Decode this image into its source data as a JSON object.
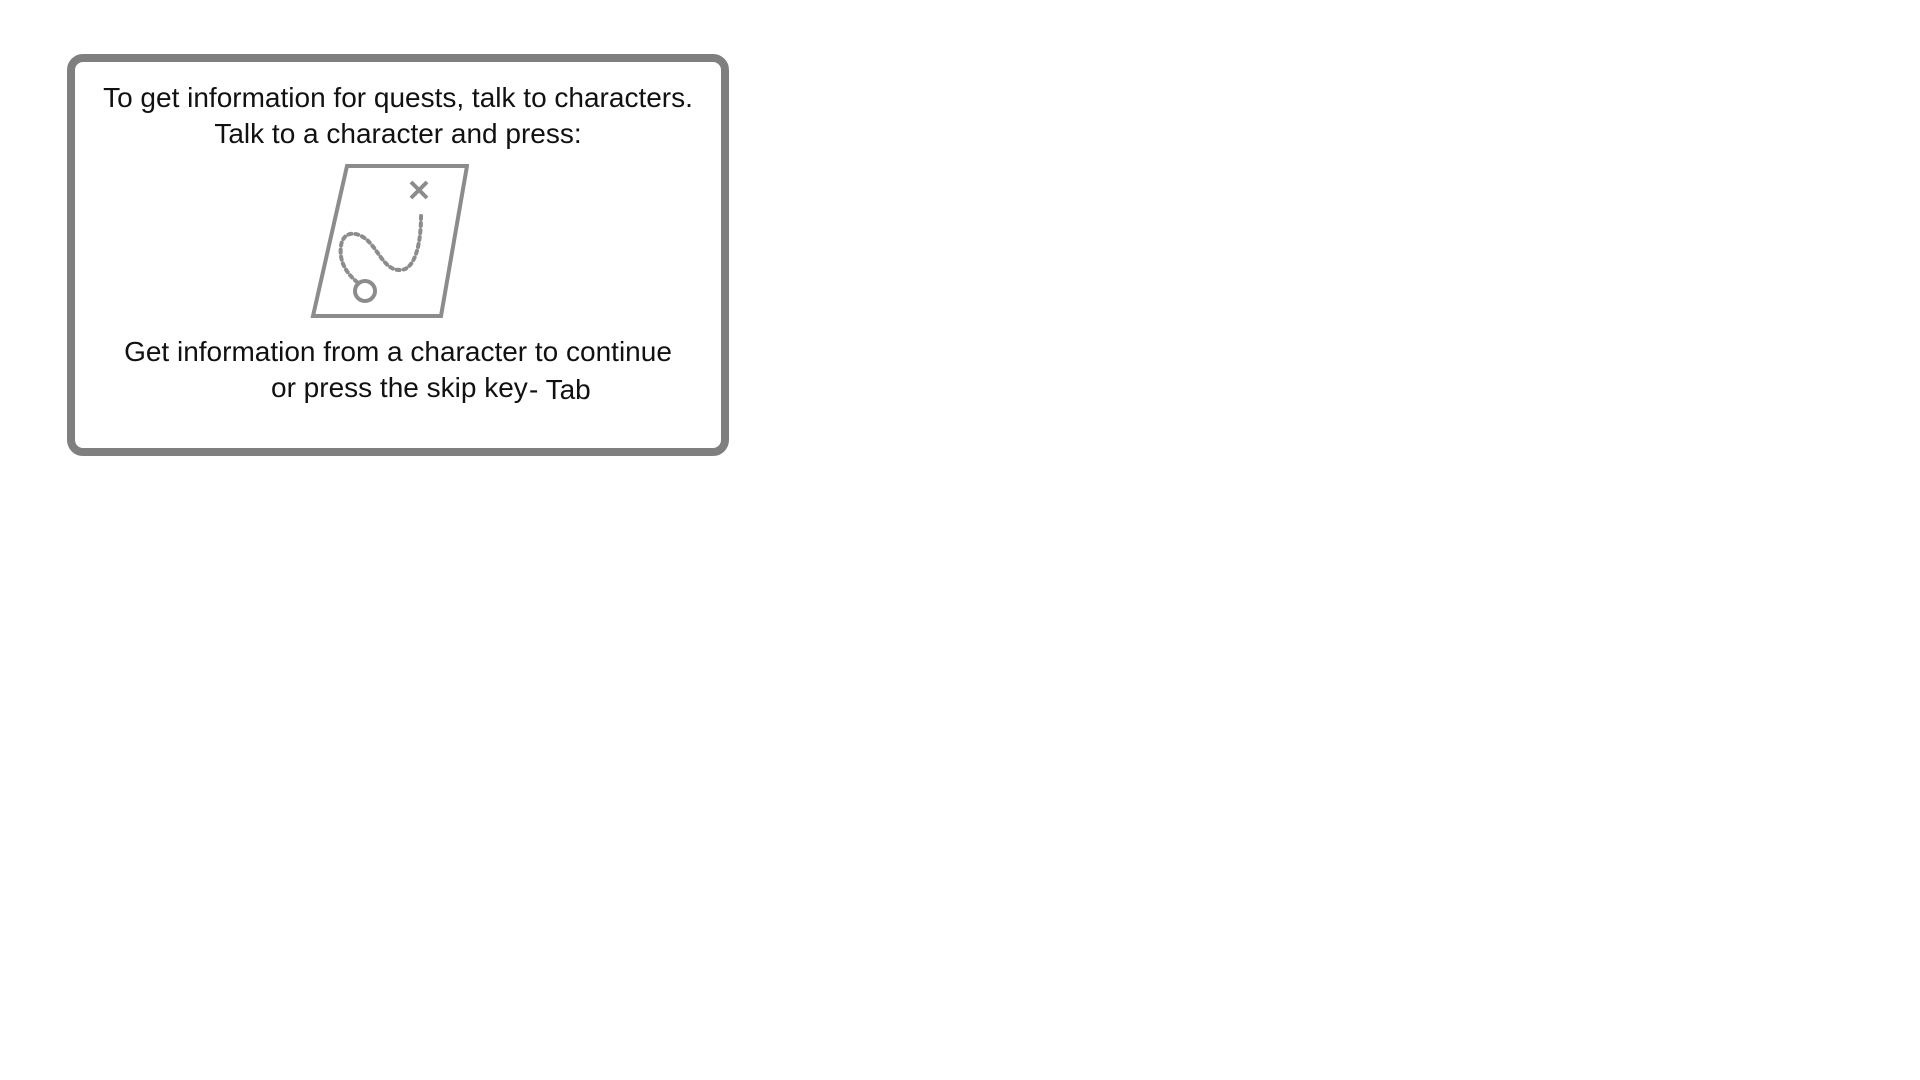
{
  "tooltip": {
    "line1": "To get information for quests, talk to characters.",
    "line2": "Talk to a character and press:",
    "icon": "quest-map-icon",
    "line3": "Get information from a character to continue",
    "skip_text": "or press the skip key",
    "skip_key": "- Tab"
  },
  "colors": {
    "border": "#7f7f7f",
    "icon": "#8c8c8c",
    "text": "#111111",
    "background": "#ffffff"
  }
}
